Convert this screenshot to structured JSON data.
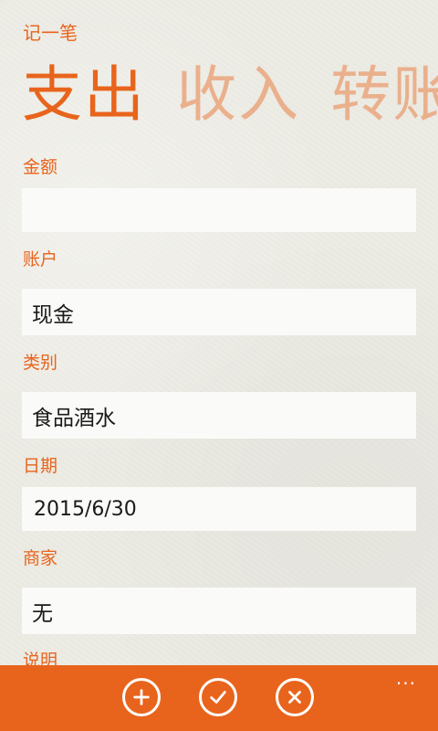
{
  "app": {
    "title": "记一笔"
  },
  "pivot": {
    "items": [
      "支出",
      "收入",
      "转账"
    ]
  },
  "form": {
    "amount": {
      "label": "金额",
      "value": ""
    },
    "account": {
      "label": "账户",
      "value": "现金"
    },
    "category": {
      "label": "类别",
      "value": "食品酒水"
    },
    "date": {
      "label": "日期",
      "value": "2015/6/30"
    },
    "merchant": {
      "label": "商家",
      "value": "无"
    },
    "note": {
      "label": "说明"
    }
  },
  "appbar": {
    "icons": [
      "add-icon",
      "check-icon",
      "close-icon"
    ],
    "more": "..."
  },
  "colors": {
    "accent": "#e8641c",
    "inactive_pivot": "#eab08c",
    "background": "#ecebe4",
    "field": "#fafaf8"
  }
}
